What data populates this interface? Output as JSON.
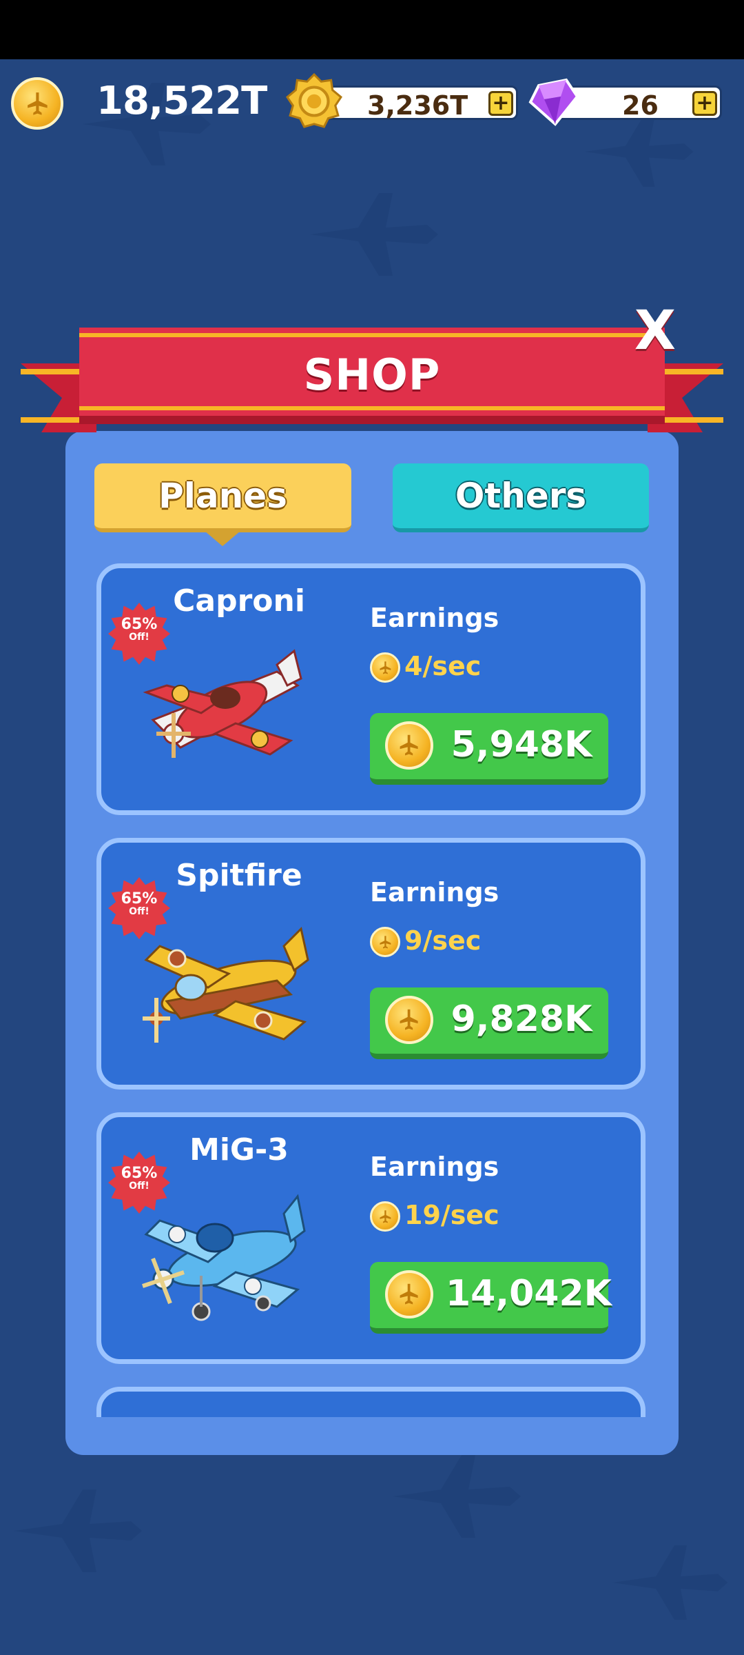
{
  "currencies": {
    "gold": "18,522T",
    "medals": "3,236T",
    "gems": "26",
    "plus_label": "+"
  },
  "shop": {
    "title": "SHOP",
    "close_label": "X",
    "tabs": [
      {
        "label": "Planes",
        "selected": true
      },
      {
        "label": "Others",
        "selected": false
      }
    ],
    "earnings_label": "Earnings",
    "items": [
      {
        "name": "Caproni",
        "discount": "65%",
        "discount_suffix": "Off!",
        "earnings": "4/sec",
        "price": "5,948K",
        "color": "#e23b44",
        "number": "1"
      },
      {
        "name": "Spitfire",
        "discount": "65%",
        "discount_suffix": "Off!",
        "earnings": "9/sec",
        "price": "9,828K",
        "color": "#f3c12c",
        "number": "2"
      },
      {
        "name": "MiG-3",
        "discount": "65%",
        "discount_suffix": "Off!",
        "earnings": "19/sec",
        "price": "14,042K",
        "color": "#5bb7ee",
        "number": "3"
      }
    ]
  },
  "colors": {
    "background": "#23467f",
    "panel": "#5b8fe8",
    "card": "#2f6fd6",
    "buy_button": "#43c84a",
    "ribbon": "#e0304a"
  }
}
